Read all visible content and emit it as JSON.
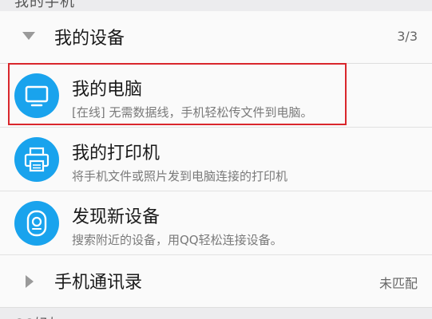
{
  "top_section": {
    "label": "我的手机"
  },
  "groups": [
    {
      "title": "我的设备",
      "count": "3/3",
      "expanded": true
    },
    {
      "title": "手机通讯录",
      "count": "未匹配",
      "expanded": false
    }
  ],
  "devices": [
    {
      "name": "我的电脑",
      "status": "[在线]",
      "desc": "无需数据线，手机轻松传文件到电脑。",
      "icon": "monitor-icon"
    },
    {
      "name": "我的打印机",
      "desc": "将手机文件或照片发到电脑连接的打印机",
      "icon": "printer-icon"
    },
    {
      "name": "发现新设备",
      "desc": "搜索附近的设备，用QQ轻松连接设备。",
      "icon": "device-discover-icon"
    }
  ],
  "bottom_section": {
    "label": "QQ好友"
  },
  "colors": {
    "accent": "#19a3ed",
    "highlight": "#d9262c",
    "background": "#ececee",
    "row_bg": "#fafafa"
  }
}
